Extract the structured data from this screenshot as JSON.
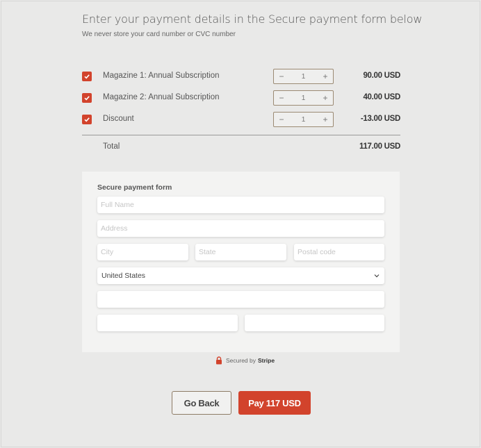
{
  "header": {
    "title": "Enter your payment details in the Secure payment form below",
    "subtitle": "We never store your card number or CVC number"
  },
  "items": [
    {
      "label": "Magazine 1: Annual Subscription",
      "qty": "1",
      "price": "90.00 USD",
      "checked": true
    },
    {
      "label": "Magazine 2: Annual Subscription",
      "qty": "1",
      "price": "40.00 USD",
      "checked": true
    },
    {
      "label": "Discount",
      "qty": "1",
      "price": "-13.00 USD",
      "checked": true
    }
  ],
  "stepper": {
    "minus": "−",
    "plus": "+"
  },
  "total": {
    "label": "Total",
    "value": "117.00 USD"
  },
  "form": {
    "heading": "Secure payment form",
    "full_name_placeholder": "Full Name",
    "address_placeholder": "Address",
    "city_placeholder": "City",
    "state_placeholder": "State",
    "postal_placeholder": "Postal code",
    "country_value": "United States"
  },
  "secured": {
    "prefix": "Secured by",
    "brand": "Stripe"
  },
  "actions": {
    "back_label": "Go Back",
    "pay_label": "Pay 117 USD"
  },
  "colors": {
    "accent": "#d2432c",
    "border": "#8d7b65",
    "background": "#e9e9e8"
  }
}
